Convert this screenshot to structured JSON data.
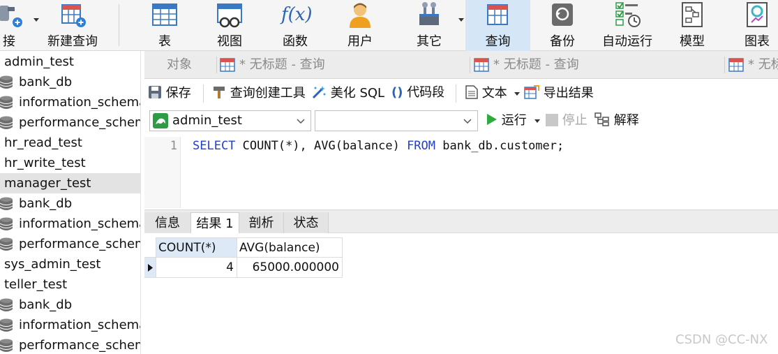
{
  "toolbar": {
    "items": [
      {
        "label": "连接",
        "shown": "接",
        "icon": "connection-icon"
      },
      {
        "label": "新建查询",
        "icon": "new-query-icon"
      },
      {
        "label": "表",
        "icon": "table-icon"
      },
      {
        "label": "视图",
        "icon": "view-icon"
      },
      {
        "label": "函数",
        "icon": "function-icon",
        "glyph": "f(x)"
      },
      {
        "label": "用户",
        "icon": "user-icon"
      },
      {
        "label": "其它",
        "icon": "other-icon"
      },
      {
        "label": "查询",
        "icon": "query-icon"
      },
      {
        "label": "备份",
        "icon": "backup-icon"
      },
      {
        "label": "自动运行",
        "icon": "automation-icon"
      },
      {
        "label": "模型",
        "icon": "model-icon"
      },
      {
        "label": "图表",
        "icon": "chart-icon"
      }
    ],
    "accent": "#d5e6f6"
  },
  "sidebar": {
    "items": [
      {
        "label": "admin_test",
        "type": "connection"
      },
      {
        "label": "bank_db",
        "type": "database"
      },
      {
        "label": "information_schema",
        "type": "database"
      },
      {
        "label": "performance_schema",
        "type": "database"
      },
      {
        "label": "hr_read_test",
        "type": "connection"
      },
      {
        "label": "hr_write_test",
        "type": "connection"
      },
      {
        "label": "manager_test",
        "type": "connection",
        "selected": true
      },
      {
        "label": "bank_db",
        "type": "database"
      },
      {
        "label": "information_schema",
        "type": "database"
      },
      {
        "label": "performance_schema",
        "type": "database"
      },
      {
        "label": "sys_admin_test",
        "type": "connection"
      },
      {
        "label": "teller_test",
        "type": "connection"
      },
      {
        "label": "bank_db",
        "type": "database"
      },
      {
        "label": "information_schema",
        "type": "database"
      },
      {
        "label": "performance_schema",
        "type": "database"
      }
    ]
  },
  "tabs": {
    "objects": "对象",
    "query_tabs": [
      "* 无标题 - 查询",
      "* 无标题 - 查询",
      "* 无标"
    ]
  },
  "editor_toolbar": {
    "save": "保存",
    "query_builder": "查询创建工具",
    "beautify": "美化 SQL",
    "snippet": "代码段",
    "text": "文本",
    "export": "导出结果",
    "connection_value": "admin_test",
    "database_value": "",
    "run": "运行",
    "stop": "停止",
    "explain": "解释"
  },
  "editor": {
    "line_number": "1",
    "sql": {
      "kw1": "SELECT",
      "part1": " COUNT(*), AVG(balance) ",
      "kw2": "FROM",
      "part2": " bank_db.customer;"
    }
  },
  "result_tabs": [
    "信息",
    "结果 1",
    "剖析",
    "状态"
  ],
  "result": {
    "columns": [
      "COUNT(*)",
      "AVG(balance)"
    ],
    "rows": [
      [
        "4",
        "65000.000000"
      ]
    ]
  },
  "watermark": "CSDN @CC-NX"
}
